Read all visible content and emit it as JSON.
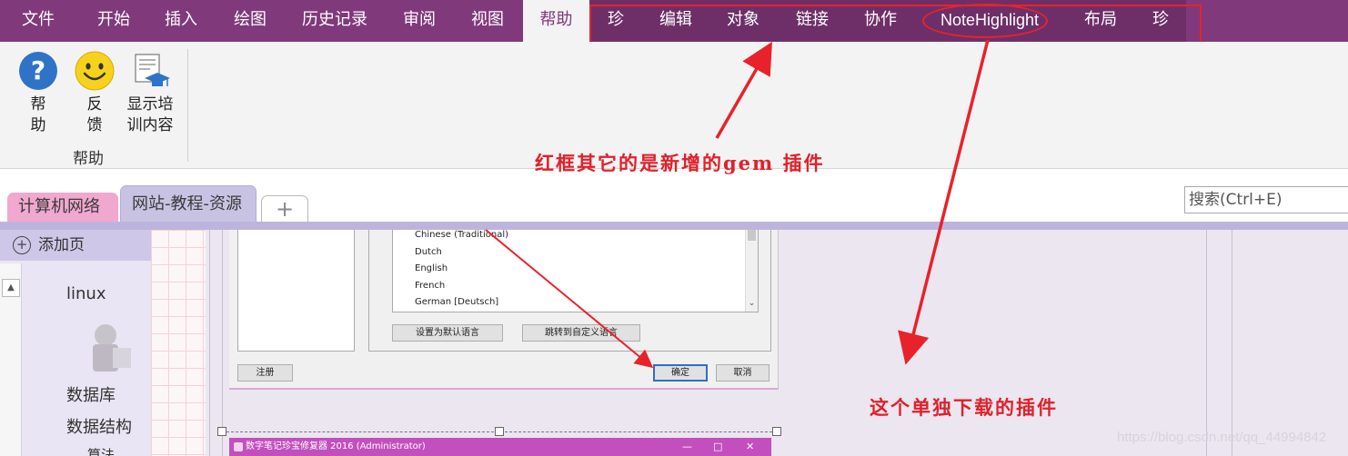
{
  "ribbon_tabs": [
    {
      "label": "文件"
    },
    {
      "label": "开始"
    },
    {
      "label": "插入"
    },
    {
      "label": "绘图"
    },
    {
      "label": "历史记录"
    },
    {
      "label": "审阅"
    },
    {
      "label": "视图"
    },
    {
      "label": "帮助",
      "active": true
    },
    {
      "label": "珍"
    },
    {
      "label": "编辑"
    },
    {
      "label": "对象"
    },
    {
      "label": "链接"
    },
    {
      "label": "协作"
    },
    {
      "label": "NoteHighlight"
    },
    {
      "label": "布局"
    },
    {
      "label": "珍"
    }
  ],
  "ribbon": {
    "buttons": [
      {
        "icon": "help-icon",
        "label_line1": "帮",
        "label_line2": "助"
      },
      {
        "icon": "smiley-icon",
        "label_line1": "反",
        "label_line2": "馈"
      },
      {
        "icon": "training-icon",
        "label_line1": "显示培",
        "label_line2": "训内容"
      }
    ],
    "group_label": "帮助"
  },
  "section_tabs": [
    {
      "label": "计算机网络",
      "color": "#f0a8cf"
    },
    {
      "label": "网站-教程-资源",
      "color": "#c9c3e3",
      "active": true
    }
  ],
  "add_section_symbol": "+",
  "search_placeholder": "搜索(Ctrl+E)",
  "page_panel": {
    "add_page_label": "添加页",
    "pages": [
      "linux",
      "数据库",
      "数据结构",
      "算法"
    ]
  },
  "embedded_dialog": {
    "languages": [
      "Chinese (Traditional)",
      "Dutch",
      "English",
      "French",
      "German [Deutsch]"
    ],
    "btn_set_default": "设置为默认语言",
    "btn_jump_custom": "跳转到自定义语言",
    "btn_register": "注册",
    "btn_ok": "确定",
    "btn_cancel": "取消"
  },
  "second_window_title": "数字笔记珍宝修复器 2016 (Administrator)",
  "second_window_controls": [
    "—",
    "□",
    "✕"
  ],
  "annotations": {
    "red_box_note": "红框其它的是新增的gem 插件",
    "separate_download_note": "这个单独下载的插件"
  },
  "watermark": "https://blog.csdn.net/qq_44994842",
  "colors": {
    "ribbon_purple": "#80397b",
    "annotation_red": "#e1202a",
    "section_pink": "#f0a8cf",
    "section_lavender": "#c9c3e3"
  }
}
